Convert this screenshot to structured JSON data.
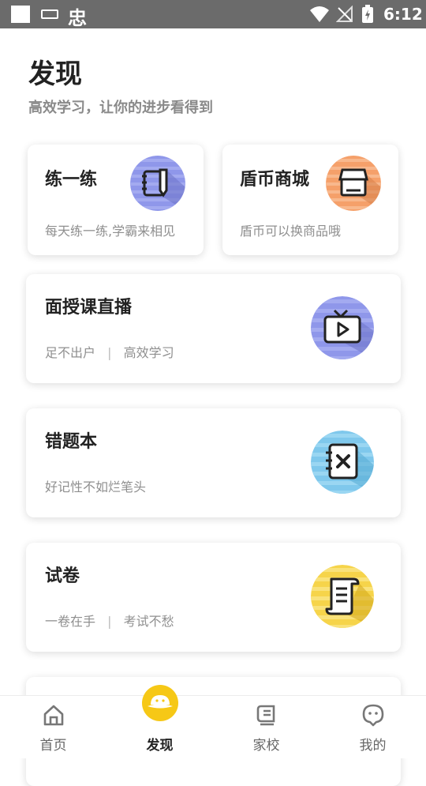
{
  "status_bar": {
    "time": "6:12",
    "app_glyph": "忠"
  },
  "page": {
    "title": "发现",
    "subtitle": "高效学习，让你的进步看得到"
  },
  "cards": {
    "practice": {
      "title": "练一练",
      "desc": "每天练一练,学霸来相见",
      "icon": "notebook-pen-icon",
      "color": "#8f97ea"
    },
    "shop": {
      "title": "盾币商城",
      "desc": "盾币可以换商品哦",
      "icon": "shop-icon",
      "color": "#f5a06a"
    },
    "live": {
      "title": "面授课直播",
      "desc_left": "足不出户",
      "desc_sep": "|",
      "desc_right": "高效学习",
      "icon": "tv-play-icon",
      "color": "#8f97ea"
    },
    "mistakes": {
      "title": "错题本",
      "desc": "好记性不如烂笔头",
      "icon": "mistake-book-icon",
      "color": "#7fc8ec"
    },
    "papers": {
      "title": "试卷",
      "desc_left": "一卷在手",
      "desc_sep": "|",
      "desc_right": "考试不愁",
      "icon": "scroll-paper-icon",
      "color": "#f6d44a"
    }
  },
  "tabbar": {
    "items": [
      {
        "label": "首页",
        "icon": "home-icon"
      },
      {
        "label": "发现",
        "icon": "planet-icon",
        "active": true
      },
      {
        "label": "家校",
        "icon": "school-book-icon"
      },
      {
        "label": "我的",
        "icon": "profile-face-icon"
      }
    ]
  }
}
